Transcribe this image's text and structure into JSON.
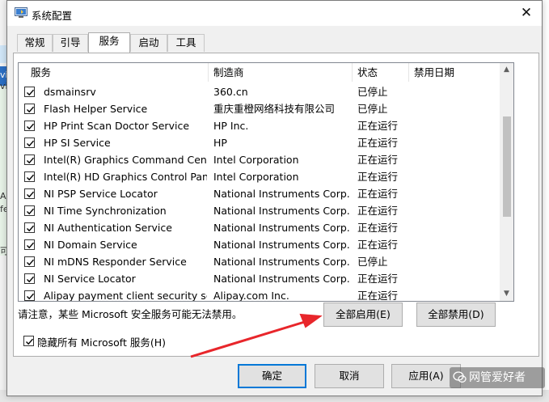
{
  "window": {
    "title": "系统配置",
    "close_glyph": "✕"
  },
  "tabs": [
    {
      "label": "常规",
      "active": false
    },
    {
      "label": "引导",
      "active": false
    },
    {
      "label": "服务",
      "active": true
    },
    {
      "label": "启动",
      "active": false
    },
    {
      "label": "工具",
      "active": false
    }
  ],
  "services_table": {
    "columns": [
      "服务",
      "制造商",
      "状态",
      "禁用日期"
    ],
    "rows": [
      {
        "name": "dsmainsrv",
        "manufacturer": "360.cn",
        "status": "已停止",
        "checked": true
      },
      {
        "name": "Flash Helper Service",
        "manufacturer": "重庆重橙网络科技有限公司",
        "status": "已停止",
        "checked": true
      },
      {
        "name": "HP Print Scan Doctor Service",
        "manufacturer": "HP Inc.",
        "status": "正在运行",
        "checked": true
      },
      {
        "name": "HP SI Service",
        "manufacturer": "HP",
        "status": "正在运行",
        "checked": true
      },
      {
        "name": "Intel(R) Graphics Command Cent...",
        "manufacturer": "Intel Corporation",
        "status": "正在运行",
        "checked": true
      },
      {
        "name": "Intel(R) HD Graphics Control Pan...",
        "manufacturer": "Intel Corporation",
        "status": "正在运行",
        "checked": true
      },
      {
        "name": "NI PSP Service Locator",
        "manufacturer": "National Instruments Corp...",
        "status": "正在运行",
        "checked": true
      },
      {
        "name": "NI Time Synchronization",
        "manufacturer": "National Instruments Corp...",
        "status": "正在运行",
        "checked": true
      },
      {
        "name": "NI Authentication Service",
        "manufacturer": "National Instruments Corp...",
        "status": "正在运行",
        "checked": true
      },
      {
        "name": "NI Domain Service",
        "manufacturer": "National Instruments Corp...",
        "status": "正在运行",
        "checked": true
      },
      {
        "name": "NI mDNS Responder Service",
        "manufacturer": "National Instruments Corp...",
        "status": "已停止",
        "checked": true
      },
      {
        "name": "NI Service Locator",
        "manufacturer": "National Instruments Corp...",
        "status": "正在运行",
        "checked": true
      },
      {
        "name": "Alipay payment client security ser...",
        "manufacturer": "Alipay.com Inc.",
        "status": "正在运行",
        "checked": true
      }
    ]
  },
  "note": "请注意，某些 Microsoft 安全服务可能无法禁用。",
  "buttons": {
    "enable_all": "全部启用(E)",
    "disable_all": "全部禁用(D)",
    "ok": "确定",
    "cancel": "取消",
    "apply": "应用(A)"
  },
  "hide_microsoft": {
    "label": "隐藏所有 Microsoft 服务(H)",
    "checked": true
  },
  "watermark": "网管爱好者",
  "background_fragments": [
    "vi",
    "vi",
    "Ap",
    "fe",
    "可"
  ],
  "annotation_arrow_color": "#e8262b"
}
